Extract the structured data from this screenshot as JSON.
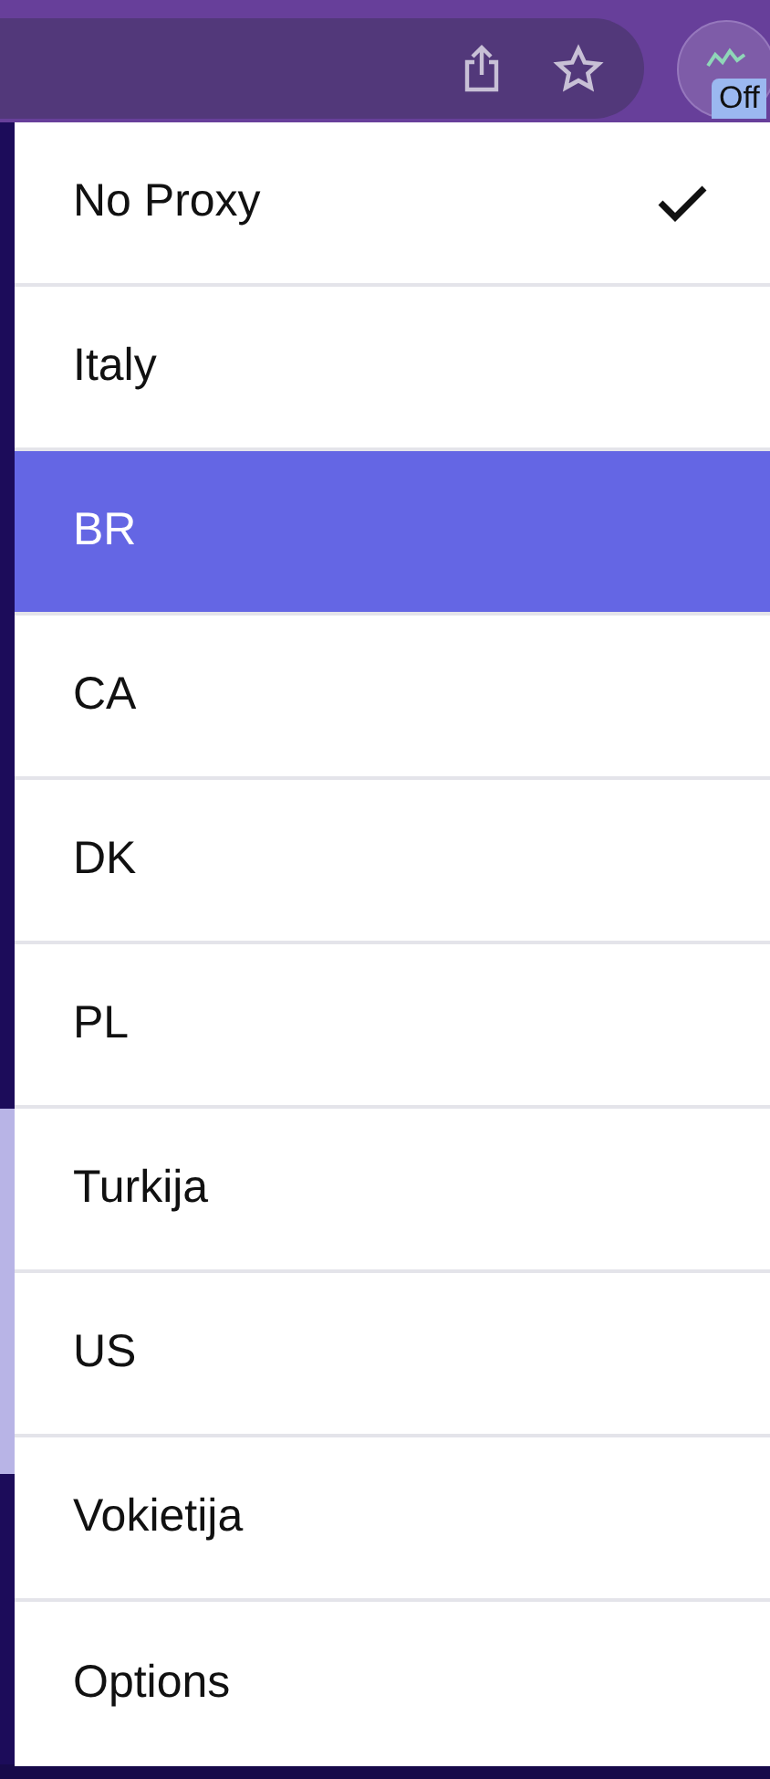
{
  "toolbar": {
    "extension_badge": "Off"
  },
  "menu": {
    "items": [
      {
        "label": "No Proxy",
        "selected": false,
        "checked": true
      },
      {
        "label": "Italy",
        "selected": false,
        "checked": false
      },
      {
        "label": "BR",
        "selected": true,
        "checked": false
      },
      {
        "label": "CA",
        "selected": false,
        "checked": false
      },
      {
        "label": "DK",
        "selected": false,
        "checked": false
      },
      {
        "label": "PL",
        "selected": false,
        "checked": false
      },
      {
        "label": "Turkija",
        "selected": false,
        "checked": false
      },
      {
        "label": "US",
        "selected": false,
        "checked": false
      },
      {
        "label": "Vokietija",
        "selected": false,
        "checked": false
      },
      {
        "label": "Options",
        "selected": false,
        "checked": false
      }
    ]
  }
}
